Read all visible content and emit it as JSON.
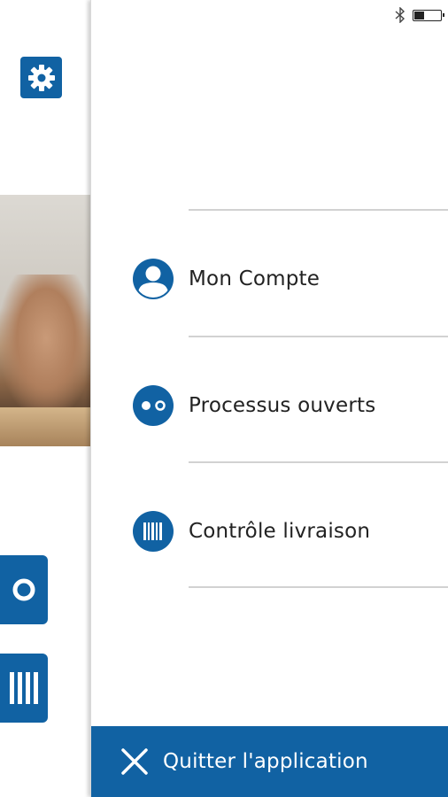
{
  "colors": {
    "accent": "#1162a3",
    "text": "#222222",
    "divider": "#d2d2d2",
    "quit_text": "#ffffff"
  },
  "status_bar": {
    "bluetooth_icon": "bluetooth-icon",
    "battery_icon": "battery-icon",
    "battery_level": 0.4
  },
  "background": {
    "settings_icon": "gear-icon",
    "tile_icons": [
      "circle-icon",
      "barcode-icon"
    ]
  },
  "menu": {
    "items": [
      {
        "label": "Mon Compte",
        "icon": "user-icon"
      },
      {
        "label": "Processus ouverts",
        "icon": "open-processes-icon"
      },
      {
        "label": "Contrôle livraison",
        "icon": "barcode-icon"
      }
    ]
  },
  "quit": {
    "label": "Quitter l'application",
    "icon": "close-icon"
  }
}
